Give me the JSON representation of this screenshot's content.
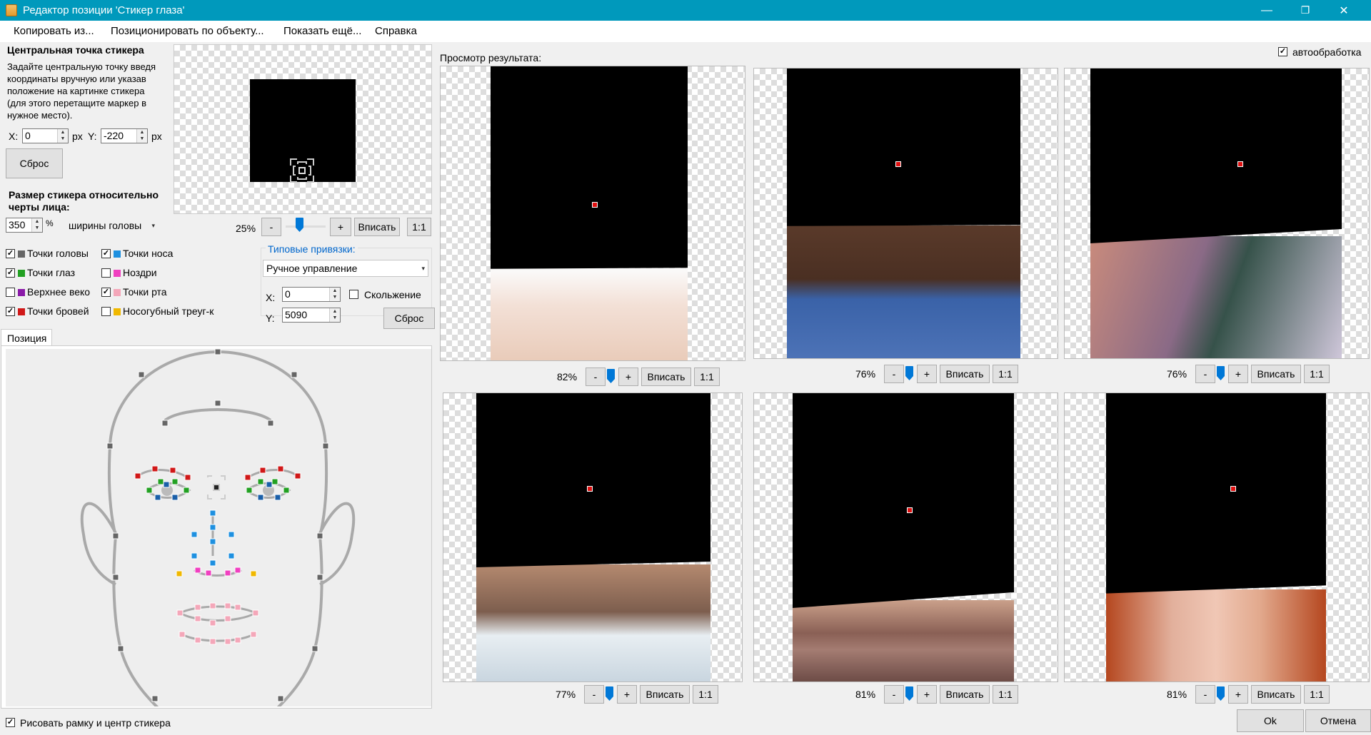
{
  "window": {
    "title": "Редактор позиции 'Стикер глаза'",
    "minimize": "—",
    "maximize": "❐",
    "close": "✕"
  },
  "menu": [
    "Копировать из...",
    "Позиционировать по объекту...",
    "Показать ещё...",
    "Справка"
  ],
  "center": {
    "heading": "Центральная точка стикера",
    "description": "Задайте центральную точку введя координаты вручную или указав положение на картинке стикера (для этого перетащите маркер в нужное место).",
    "x_label": "X:",
    "x_value": "0",
    "x_unit": "px",
    "y_label": "Y:",
    "y_value": "-220",
    "y_unit": "px",
    "reset": "Сброс"
  },
  "size": {
    "heading": "Размер стикера относительно черты лица:",
    "value": "350",
    "unit": "%",
    "basis": "ширины головы"
  },
  "sticker_zoom": {
    "percent": "25%",
    "minus": "-",
    "plus": "+",
    "fit": "Вписать",
    "one": "1:1",
    "level": 0.25
  },
  "points": [
    {
      "label": "Точки головы",
      "checked": true,
      "color": "#666666"
    },
    {
      "label": "Точки носа",
      "checked": true,
      "color": "#1e90e0"
    },
    {
      "label": "Точки глаз",
      "checked": true,
      "color": "#22a022"
    },
    {
      "label": "Ноздри",
      "checked": false,
      "color": "#f040c0"
    },
    {
      "label": "Верхнее веко",
      "checked": false,
      "color": "#8a1aa8"
    },
    {
      "label": "Точки рта",
      "checked": true,
      "color": "#f4a7b9"
    },
    {
      "label": "Точки бровей",
      "checked": true,
      "color": "#d01818"
    },
    {
      "label": "Носогубный треуг-к",
      "checked": false,
      "color": "#f0b800"
    }
  ],
  "anchors": {
    "legend": "Типовые привязки:",
    "mode": "Ручное управление",
    "x_label": "X:",
    "x_value": "0",
    "y_label": "Y:",
    "y_value": "5090",
    "slide": "Скольжение",
    "slide_checked": false,
    "reset": "Сброс"
  },
  "position_tab": "Позиция",
  "draw_frame": {
    "label": "Рисовать рамку и центр стикера",
    "checked": true
  },
  "preview": {
    "label": "Просмотр результата:",
    "auto": "автообработка",
    "auto_checked": true
  },
  "previews": [
    {
      "percent": "82%",
      "level": 0.82,
      "face": "smile-woman"
    },
    {
      "percent": "76%",
      "level": 0.76,
      "face": "man-blue-suit"
    },
    {
      "percent": "76%",
      "level": 0.76,
      "face": "child"
    },
    {
      "percent": "77%",
      "level": 0.77,
      "face": "man-beard"
    },
    {
      "percent": "81%",
      "level": 0.81,
      "face": "woman-fur"
    },
    {
      "percent": "81%",
      "level": 0.81,
      "face": "red-hair-woman"
    }
  ],
  "zoom_buttons": {
    "minus": "-",
    "plus": "+",
    "fit": "Вписать",
    "one": "1:1"
  },
  "footer": {
    "ok": "Ok",
    "cancel": "Отмена"
  }
}
